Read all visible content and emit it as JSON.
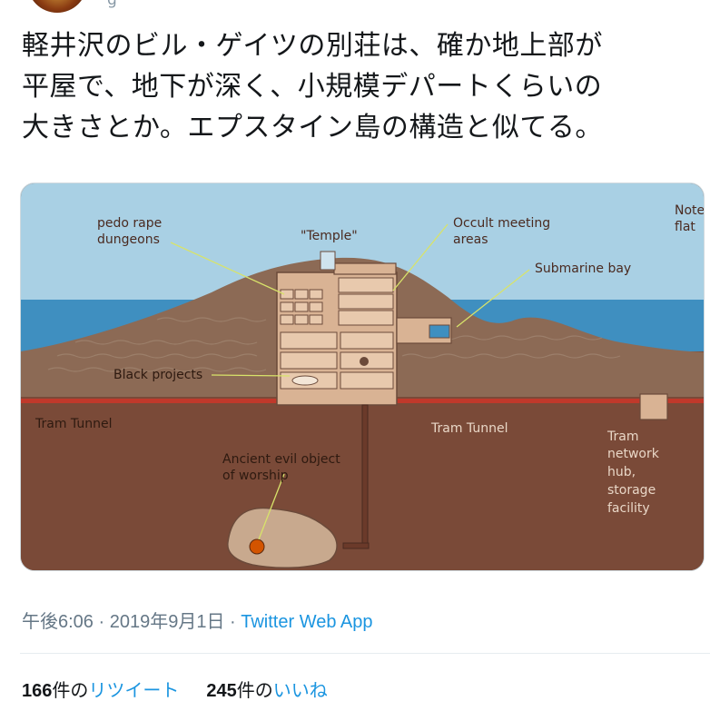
{
  "header": {
    "name_fragment": "g"
  },
  "tweet": {
    "line1": "軽井沢のビル・ゲイツの別荘は、確か地上部が",
    "line2": "平屋で、地下が深く、小規模デパートくらいの",
    "line3": "大きさとか。エプスタイン島の構造と似てる。"
  },
  "diagram": {
    "labels": {
      "pedo_1": "pedo rape",
      "pedo_2": "dungeons",
      "temple": "\"Temple\"",
      "occult_1": "Occult meeting",
      "occult_2": "areas",
      "note_1": "Note",
      "note_2": "flat",
      "submarine": "Submarine bay",
      "black": "Black projects",
      "tram_left": "Tram Tunnel",
      "tram_mid": "Tram Tunnel",
      "hub_1": "Tram",
      "hub_2": "network",
      "hub_3": "hub,",
      "hub_4": "storage",
      "hub_5": "facility",
      "ancient_1": "Ancient evil object",
      "ancient_2": "of worship"
    },
    "colors": {
      "sky": "#a9d0e4",
      "sea": "#3f8fc0",
      "ground": "#7a4a38",
      "hill": "#8c6a55",
      "building": "#d9b394",
      "tunnel": "#c0392b"
    }
  },
  "meta": {
    "time": "午後6:06",
    "sep1": " · ",
    "date": "2019年9月1日",
    "sep2": " · ",
    "app": "Twitter Web App"
  },
  "stats": {
    "retweets_count": "166",
    "retweets_unit": "件の",
    "retweets_label": "リツイート",
    "likes_count": "245",
    "likes_unit": "件の",
    "likes_label": "いいね"
  }
}
